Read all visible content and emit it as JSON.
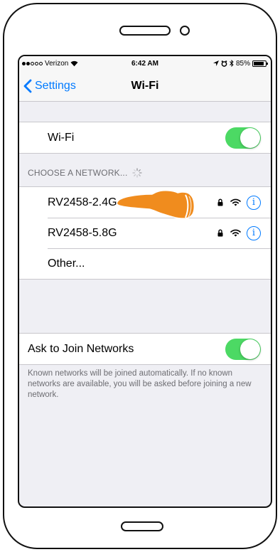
{
  "status_bar": {
    "carrier": "Verizon",
    "time": "6:42 AM",
    "battery": "85%"
  },
  "nav": {
    "back_label": "Settings",
    "title": "Wi-Fi"
  },
  "wifi_toggle": {
    "label": "Wi-Fi",
    "on": true
  },
  "networks_section": {
    "header": "CHOOSE A NETWORK..."
  },
  "networks": [
    {
      "name": "RV2458-2.4G",
      "secured": true
    },
    {
      "name": "RV2458-5.8G",
      "secured": true
    },
    {
      "name": "Other..."
    }
  ],
  "ask_to_join": {
    "label": "Ask to Join Networks",
    "on": true,
    "description": "Known networks will be joined automatically. If no known networks are available, you will be asked before joining a new network."
  },
  "colors": {
    "accent": "#007aff",
    "toggle_on": "#4cd964",
    "pointer_hand": "#f08c1e"
  },
  "icons": [
    "wifi-icon",
    "lock-icon",
    "info-icon",
    "location-icon",
    "alarm-icon",
    "bluetooth-icon",
    "battery-icon",
    "spinner-icon",
    "hand-pointer-icon"
  ]
}
